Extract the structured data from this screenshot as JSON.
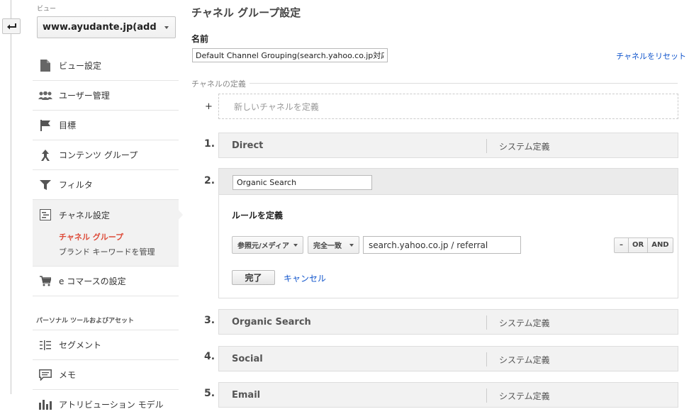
{
  "sidebar": {
    "view_label": "ビュー",
    "view_value": "www.ayudante.jp(add ...",
    "items": [
      {
        "label": "ビュー設定",
        "icon": "document-icon"
      },
      {
        "label": "ユーザー管理",
        "icon": "users-icon"
      },
      {
        "label": "目標",
        "icon": "flag-icon"
      },
      {
        "label": "コンテンツ グループ",
        "icon": "content-group-icon"
      },
      {
        "label": "フィルタ",
        "icon": "filter-icon"
      },
      {
        "label": "チャネル設定",
        "icon": "channel-settings-icon"
      }
    ],
    "sub_items": [
      {
        "label": "チャネル グループ"
      },
      {
        "label": "ブランド キーワードを管理"
      }
    ],
    "ecommerce": {
      "label": "e コマースの設定",
      "icon": "cart-icon"
    },
    "section_header": "パーソナル ツールおよびアセット",
    "tools": [
      {
        "label": "セグメント",
        "icon": "segment-icon"
      },
      {
        "label": "メモ",
        "icon": "memo-icon"
      },
      {
        "label": "アトリビューション モデル",
        "icon": "bar-chart-icon"
      }
    ]
  },
  "main": {
    "title": "チャネル グループ設定",
    "name_label": "名前",
    "name_value": "Default Channel Grouping(search.yahoo.co.jp対応)",
    "reset_link": "チャネルをリセット",
    "definition_label": "チャネルの定義",
    "plus": "+",
    "new_channel": "新しいチャネルを定義",
    "channels": [
      {
        "num": "1.",
        "name": "Direct",
        "type": "システム定義"
      },
      {
        "num": "2.",
        "name": "Organic Search",
        "type": ""
      },
      {
        "num": "3.",
        "name": "Organic Search",
        "type": "システム定義"
      },
      {
        "num": "4.",
        "name": "Social",
        "type": "システム定義"
      },
      {
        "num": "5.",
        "name": "Email",
        "type": "システム定義"
      }
    ],
    "editor": {
      "name_value": "Organic Search",
      "rule_title": "ルールを定義",
      "dimension": "参照元/メディア",
      "match": "完全一致",
      "value": "search.yahoo.co.jp / referral",
      "op_minus": "–",
      "op_or": "OR",
      "op_and": "AND",
      "done": "完了",
      "cancel": "キャンセル"
    }
  },
  "colors": {
    "accent": "#dd4b39",
    "link": "#1155cc"
  }
}
